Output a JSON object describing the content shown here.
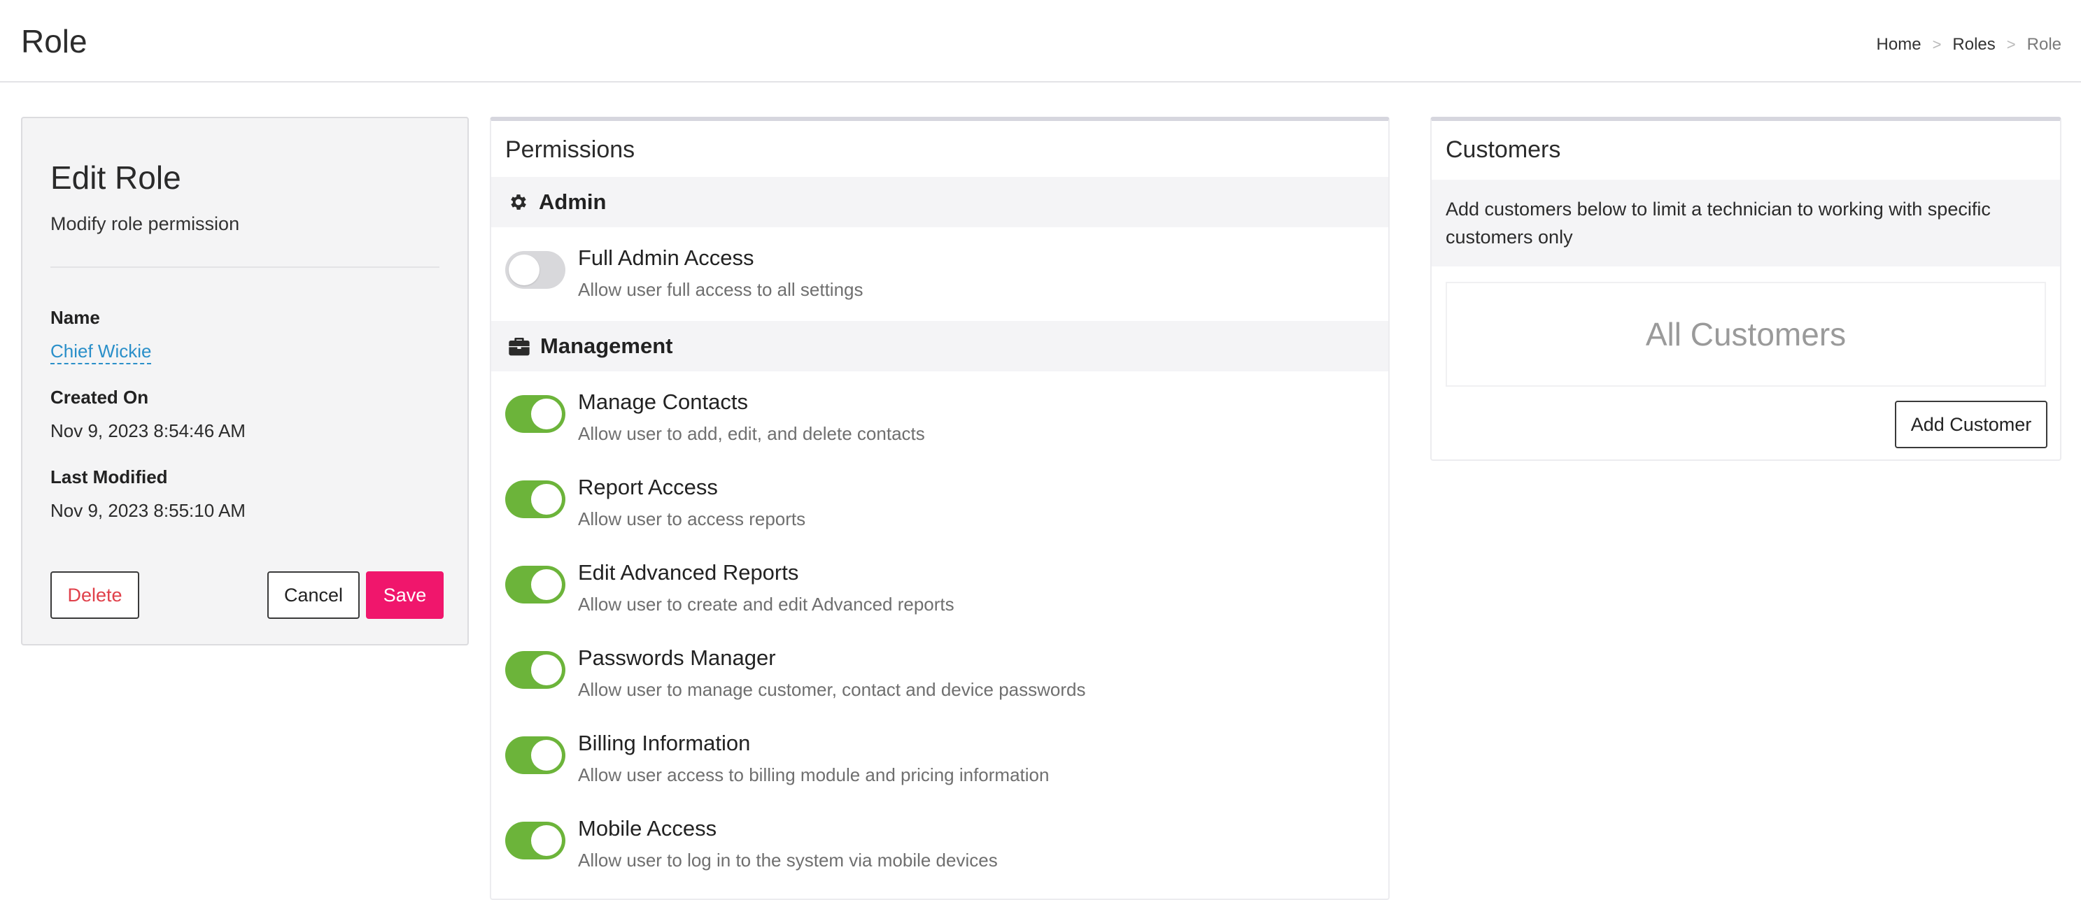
{
  "header": {
    "title": "Role",
    "breadcrumb": {
      "home": "Home",
      "roles": "Roles",
      "current": "Role",
      "separator": ">"
    }
  },
  "edit_role": {
    "title": "Edit Role",
    "subtitle": "Modify role permission",
    "name_label": "Name",
    "name_value": "Chief Wickie",
    "created_label": "Created On",
    "created_value": "Nov 9, 2023 8:54:46 AM",
    "modified_label": "Last Modified",
    "modified_value": "Nov 9, 2023 8:55:10 AM",
    "delete_label": "Delete",
    "cancel_label": "Cancel",
    "save_label": "Save"
  },
  "permissions": {
    "title": "Permissions",
    "sections": [
      {
        "name": "Admin",
        "icon": "gear-icon",
        "items": [
          {
            "title": "Full Admin Access",
            "description": "Allow user full access to all settings",
            "enabled": false
          }
        ]
      },
      {
        "name": "Management",
        "icon": "briefcase-icon",
        "items": [
          {
            "title": "Manage Contacts",
            "description": "Allow user to add, edit, and delete contacts",
            "enabled": true
          },
          {
            "title": "Report Access",
            "description": "Allow user to access reports",
            "enabled": true
          },
          {
            "title": "Edit Advanced Reports",
            "description": "Allow user to create and edit Advanced reports",
            "enabled": true
          },
          {
            "title": "Passwords Manager",
            "description": "Allow user to manage customer, contact and device passwords",
            "enabled": true
          },
          {
            "title": "Billing Information",
            "description": "Allow user access to billing module and pricing information",
            "enabled": true
          },
          {
            "title": "Mobile Access",
            "description": "Allow user to log in to the system via mobile devices",
            "enabled": true
          }
        ]
      }
    ]
  },
  "customers": {
    "title": "Customers",
    "info": "Add customers below to limit a technician to working with specific customers only",
    "empty_text": "All Customers",
    "add_label": "Add Customer"
  },
  "colors": {
    "accent_save": "#f0166c",
    "toggle_on": "#6cb43a",
    "toggle_off": "#d8d8db",
    "link": "#2a8fc9",
    "delete_text": "#e0404a"
  }
}
